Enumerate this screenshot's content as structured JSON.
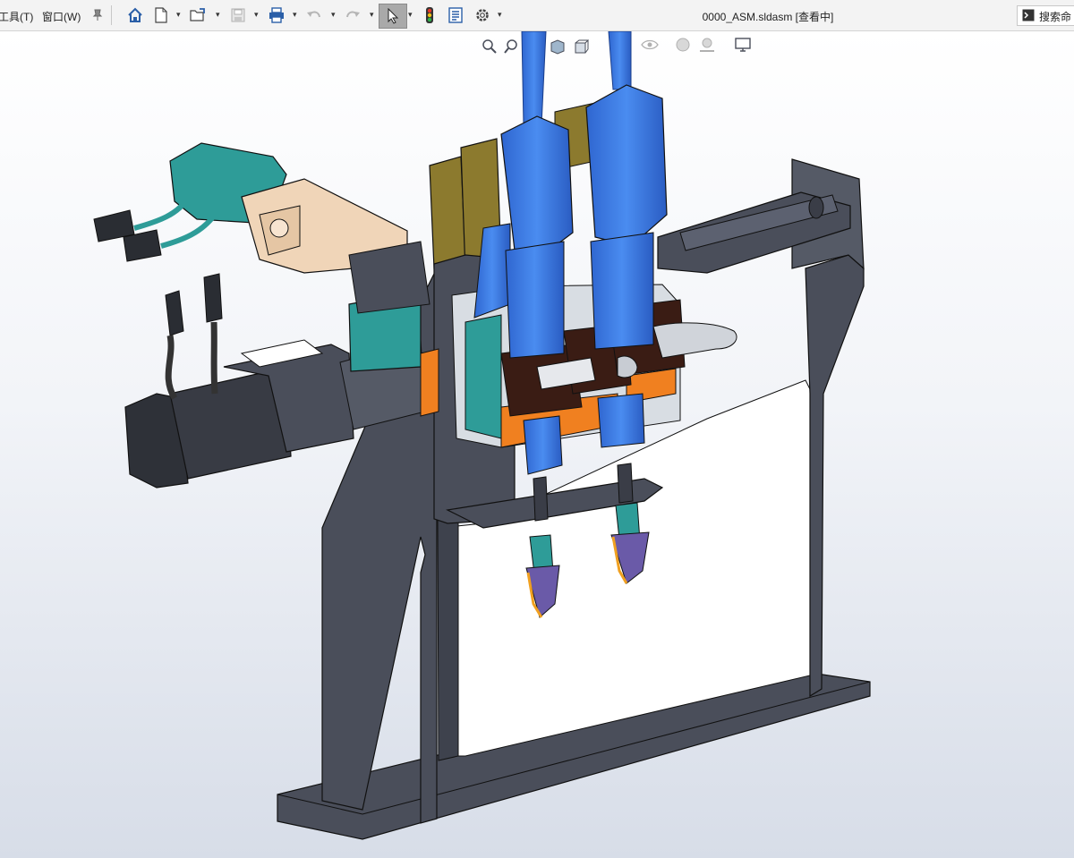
{
  "menus": {
    "tools": "工具(T)",
    "window": "窗口(W)"
  },
  "document": {
    "title": "0000_ASM.sldasm [查看中]"
  },
  "search": {
    "placeholder": "搜索命"
  },
  "toolbar_icons": [
    "pin-icon",
    "home-icon",
    "new-document-icon",
    "open-folder-icon",
    "save-icon",
    "print-icon",
    "undo-icon",
    "redo-icon",
    "select-pointer-icon",
    "traffic-light-icon",
    "file-properties-icon",
    "gear-icon"
  ],
  "view_icons": [
    "zoom-to-fit-icon",
    "zoom-area-icon",
    "previous-view-icon",
    "section-view-icon",
    "view-orientation-icon",
    "display-style-icon",
    "hide-show-icon",
    "edit-appearance-icon",
    "apply-scene-icon",
    "view-settings-icon"
  ],
  "colors": {
    "frame": "#4a4e5a",
    "blue_dispenser": "#3c7ce6",
    "teal_motor": "#2e9c98",
    "tan_slider": "#f0d5b8",
    "olive_cylinder": "#8c7a2e",
    "orange_part": "#f08020",
    "dark_brown": "#3a1c14",
    "selected_tool_bg": "#a9a9a9"
  }
}
